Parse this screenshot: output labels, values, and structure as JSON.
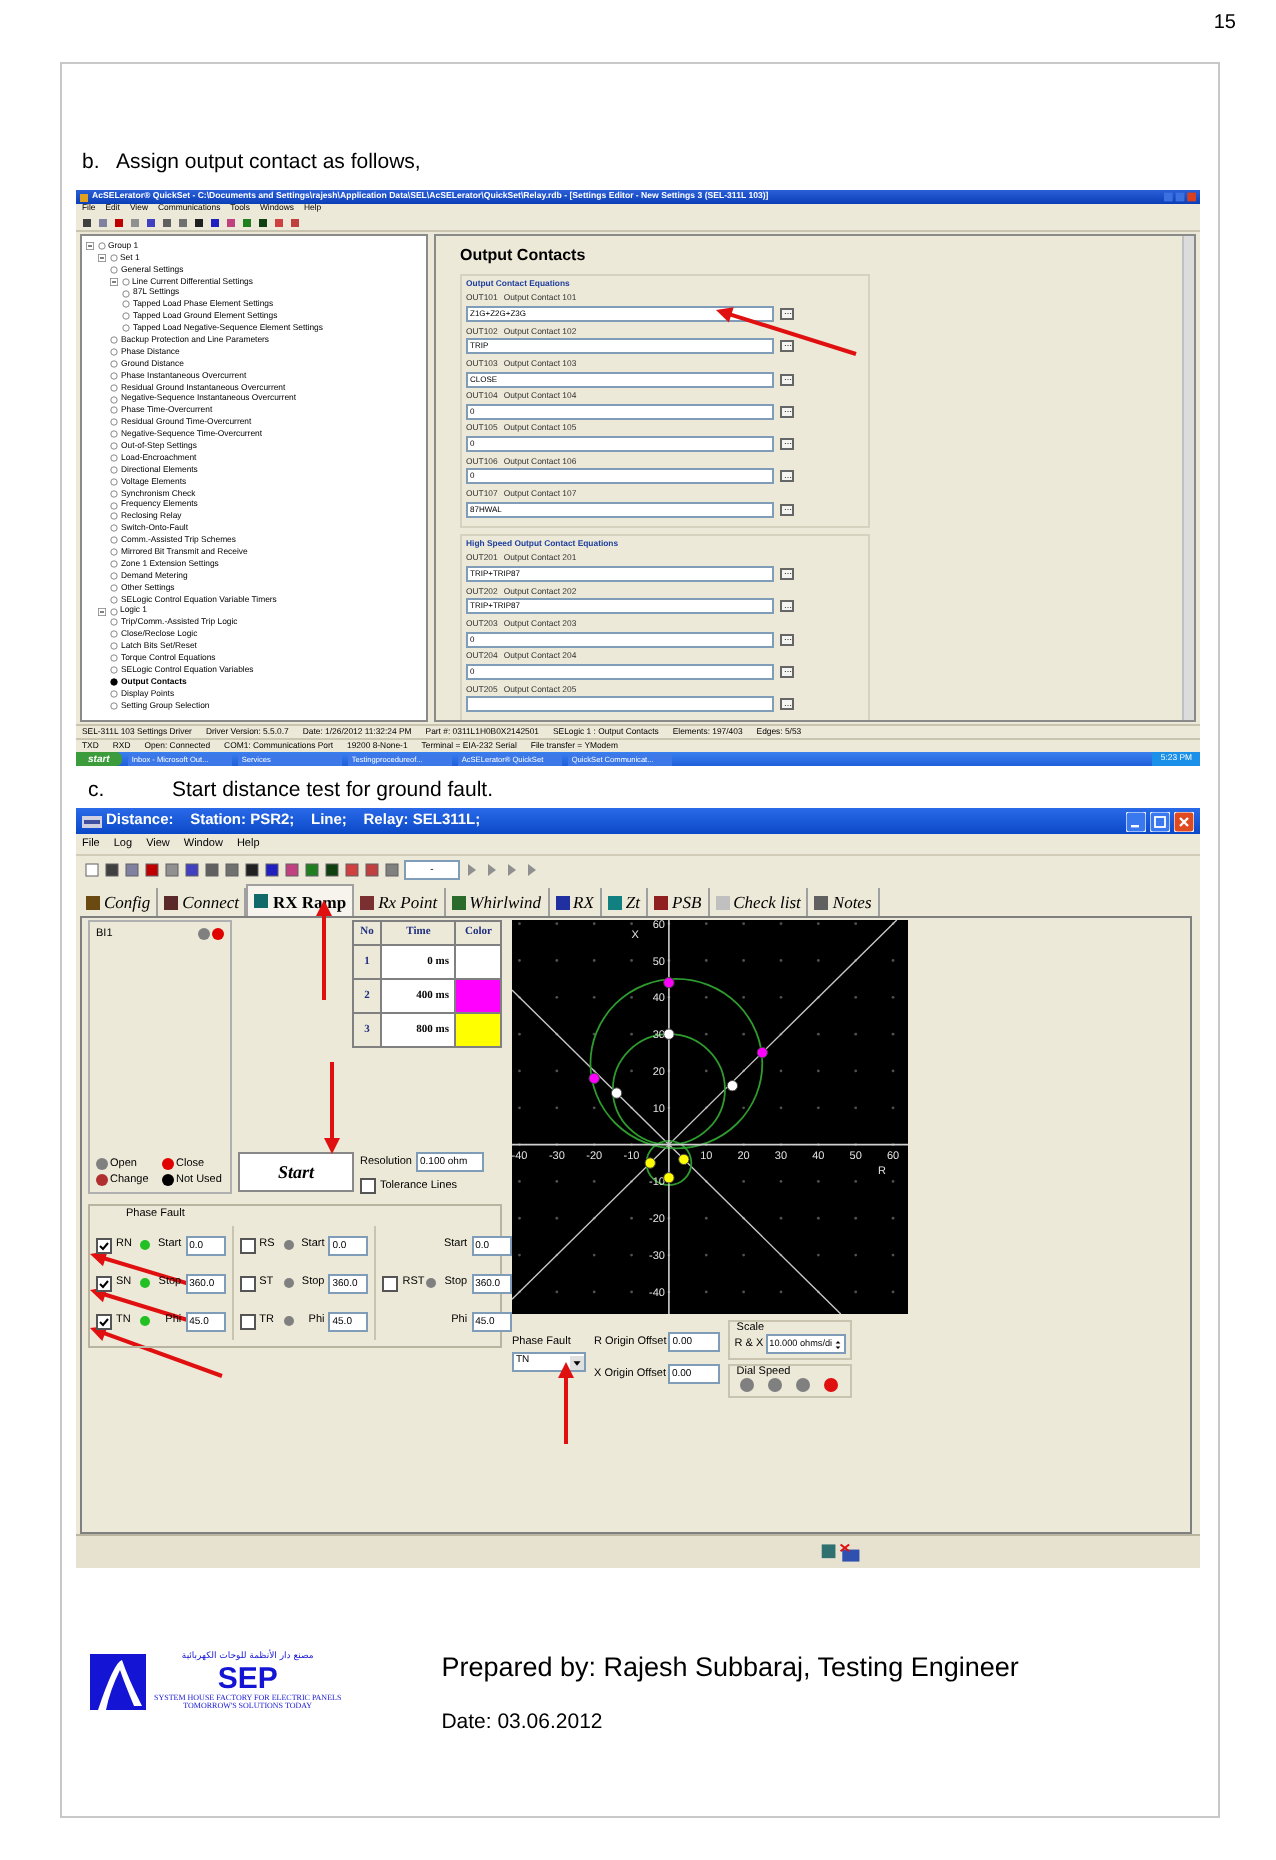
{
  "page_number": "15",
  "step_b": {
    "label": "b.",
    "text": "Assign output contact as follows,"
  },
  "quickset": {
    "title": "AcSELerator® QuickSet - C:\\Documents and Settings\\rajesh\\Application Data\\SEL\\AcSELerator\\QuickSet\\Relay.rdb - [Settings Editor - New Settings 3 (SEL-311L 103)]",
    "menu": [
      "File",
      "Edit",
      "View",
      "Communications",
      "Tools",
      "Windows",
      "Help"
    ],
    "tree": [
      {
        "label": "Group 1",
        "selected": false,
        "expanded": true,
        "children": [
          {
            "label": "Set 1",
            "selected": false,
            "expanded": true,
            "children": [
              {
                "label": "General Settings",
                "selected": false
              },
              {
                "label": "Line Current Differential Settings",
                "selected": false,
                "expanded": true,
                "children": [
                  {
                    "label": "87L Settings",
                    "selected": false
                  },
                  {
                    "label": "Tapped Load Phase Element Settings",
                    "selected": false
                  },
                  {
                    "label": "Tapped Load Ground Element Settings",
                    "selected": false
                  },
                  {
                    "label": "Tapped Load Negative-Sequence Element Settings",
                    "selected": false
                  }
                ]
              },
              {
                "label": "Backup Protection and Line Parameters",
                "selected": false
              },
              {
                "label": "Phase Distance",
                "selected": false
              },
              {
                "label": "Ground Distance",
                "selected": false
              },
              {
                "label": "Phase Instantaneous Overcurrent",
                "selected": false
              },
              {
                "label": "Residual Ground Instantaneous Overcurrent",
                "selected": false
              },
              {
                "label": "Negative-Sequence Instantaneous Overcurrent",
                "selected": false
              },
              {
                "label": "Phase Time-Overcurrent",
                "selected": false
              },
              {
                "label": "Residual Ground Time-Overcurrent",
                "selected": false
              },
              {
                "label": "Negative-Sequence Time-Overcurrent",
                "selected": false
              },
              {
                "label": "Out-of-Step Settings",
                "selected": false
              },
              {
                "label": "Load-Encroachment",
                "selected": false
              },
              {
                "label": "Directional Elements",
                "selected": false
              },
              {
                "label": "Voltage Elements",
                "selected": false
              },
              {
                "label": "Synchronism Check",
                "selected": false
              },
              {
                "label": "Frequency Elements",
                "selected": false
              },
              {
                "label": "Reclosing Relay",
                "selected": false
              },
              {
                "label": "Switch-Onto-Fault",
                "selected": false
              },
              {
                "label": "Comm.-Assisted Trip Schemes",
                "selected": false
              },
              {
                "label": "Mirrored Bit Transmit and Receive",
                "selected": false
              },
              {
                "label": "Zone 1 Extension Settings",
                "selected": false
              },
              {
                "label": "Demand Metering",
                "selected": false
              },
              {
                "label": "Other Settings",
                "selected": false
              },
              {
                "label": "SELogic Control Equation Variable Timers",
                "selected": false
              }
            ]
          },
          {
            "label": "Logic 1",
            "selected": false,
            "expanded": true,
            "children": [
              {
                "label": "Trip/Comm.-Assisted Trip Logic",
                "selected": false
              },
              {
                "label": "Close/Reclose Logic",
                "selected": false
              },
              {
                "label": "Latch Bits Set/Reset",
                "selected": false
              },
              {
                "label": "Torque Control Equations",
                "selected": false
              },
              {
                "label": "SELogic Control Equation Variables",
                "selected": false
              },
              {
                "label": "Output Contacts",
                "selected": true
              },
              {
                "label": "Display Points",
                "selected": false
              },
              {
                "label": "Setting Group Selection",
                "selected": false
              }
            ]
          }
        ]
      }
    ],
    "panel_title": "Output Contacts",
    "sections": [
      {
        "title": "Output Contact Equations",
        "fields": [
          {
            "name": "OUT101",
            "label": "Output Contact 101",
            "value": "Z1G+Z2G+Z3G"
          },
          {
            "name": "OUT102",
            "label": "Output Contact 102",
            "value": "TRIP"
          },
          {
            "name": "OUT103",
            "label": "Output Contact 103",
            "value": "CLOSE"
          },
          {
            "name": "OUT104",
            "label": "Output Contact 104",
            "value": "0"
          },
          {
            "name": "OUT105",
            "label": "Output Contact 105",
            "value": "0"
          },
          {
            "name": "OUT106",
            "label": "Output Contact 106",
            "value": "0"
          },
          {
            "name": "OUT107",
            "label": "Output Contact 107",
            "value": "87HWAL"
          }
        ]
      },
      {
        "title": "High Speed Output Contact Equations",
        "fields": [
          {
            "name": "OUT201",
            "label": "Output Contact 201",
            "value": "TRIP+TRIP87"
          },
          {
            "name": "OUT202",
            "label": "Output Contact 202",
            "value": "TRIP+TRIP87"
          },
          {
            "name": "OUT203",
            "label": "Output Contact 203",
            "value": "0"
          },
          {
            "name": "OUT204",
            "label": "Output Contact 204",
            "value": "0"
          },
          {
            "name": "OUT205",
            "label": "Output Contact 205"
          }
        ]
      }
    ],
    "status_lines": [
      [
        "SEL-311L 103 Settings Driver",
        "Driver Version: 5.5.0.7",
        "Date: 1/26/2012 11:32:24 PM",
        "Part #: 0311L1H0B0X2142501",
        "SELogic 1 : Output Contacts",
        "Elements: 197/403",
        "Edges: 5/53"
      ],
      [
        "TXD",
        "RXD",
        "Open: Connected",
        "COM1: Communications Port",
        "19200 8-None-1",
        "Terminal = EIA-232 Serial",
        "File transfer = YModem"
      ]
    ],
    "taskbar": {
      "start": "start",
      "tasks": [
        "Inbox - Microsoft Out...",
        "Services",
        "Testingprocedureof...",
        "AcSELerator® QuickSet",
        "QuickSet Communicat..."
      ],
      "clock": "5:23 PM"
    }
  },
  "step_c": {
    "label": "c.",
    "text": "Start distance test for ground fault."
  },
  "distance": {
    "title": "Distance:    Station: PSR2;    Line;    Relay: SEL311L;",
    "menu": [
      "File",
      "Log",
      "View",
      "Window",
      "Help"
    ],
    "toolbar_field": "-",
    "tabs": [
      {
        "label": "Config",
        "selected": false
      },
      {
        "label": "Connect",
        "selected": false
      },
      {
        "label": "RX Ramp",
        "selected": true
      },
      {
        "label": "Rx Point",
        "selected": false
      },
      {
        "label": "Whirlwind",
        "selected": false
      },
      {
        "label": "RX",
        "selected": false
      },
      {
        "label": "Zt",
        "selected": false
      },
      {
        "label": "PSB",
        "selected": false
      },
      {
        "label": "Check list",
        "selected": false
      },
      {
        "label": "Notes",
        "selected": false
      }
    ],
    "binary_input": {
      "label": "BI1",
      "indicators": [
        {
          "color": "#808080"
        },
        {
          "color": "#e00000"
        }
      ]
    },
    "legend": [
      {
        "label": "Open",
        "color": "#808080"
      },
      {
        "label": "Close",
        "color": "#e00000"
      },
      {
        "label": "Change",
        "color": "#b03030"
      },
      {
        "label": "Not Used",
        "color": "#000000"
      }
    ],
    "time_table": {
      "columns": [
        "No",
        "Time",
        "Color"
      ],
      "rows": [
        {
          "no": "1",
          "time": "0 ms",
          "color": "#ffffff"
        },
        {
          "no": "2",
          "time": "400 ms",
          "color": "#ff00ff"
        },
        {
          "no": "3",
          "time": "800 ms",
          "color": "#ffff00"
        }
      ]
    },
    "start_button": "Start",
    "resolution": {
      "label": "Resolution",
      "value": "0.100 ohm"
    },
    "tolerance": {
      "label": "Tolerance Lines",
      "checked": false
    },
    "chart_data": {
      "type": "scatter",
      "xlabel": "R",
      "ylabel": "X",
      "xlim": [
        -42,
        64
      ],
      "ylim": [
        -46,
        61
      ],
      "xticks": [
        -40,
        -30,
        -20,
        -10,
        10,
        20,
        30,
        40,
        50,
        60
      ],
      "yticks": [
        -40,
        -30,
        -20,
        -10,
        10,
        20,
        30,
        40,
        50,
        60
      ],
      "series": [
        {
          "color": "#ffffff",
          "x": [
            0,
            17,
            -14
          ],
          "values": [
            30,
            16,
            14
          ]
        },
        {
          "color": "#ff00ff",
          "x": [
            0,
            25,
            -20
          ],
          "values": [
            44,
            25,
            18
          ]
        },
        {
          "color": "#ffff00",
          "x": [
            -5,
            4,
            0
          ],
          "values": [
            -5,
            -4,
            -9
          ]
        }
      ]
    },
    "phase_fault": {
      "title": "Phase Fault",
      "columns": [
        [
          {
            "loop": "RN",
            "checked": true,
            "param": "Start",
            "value": "0.0"
          },
          {
            "loop": "SN",
            "checked": true,
            "param": "Stop",
            "value": "360.0"
          },
          {
            "loop": "TN",
            "checked": true,
            "param": "Phi",
            "value": "45.0"
          }
        ],
        [
          {
            "loop": "RS",
            "checked": false,
            "param": "Start",
            "value": "0.0"
          },
          {
            "loop": "ST",
            "checked": false,
            "param": "Stop",
            "value": "360.0"
          },
          {
            "loop": "TR",
            "checked": false,
            "param": "Phi",
            "value": "45.0"
          }
        ],
        [
          {
            "param": "Start",
            "value": "0.0"
          },
          {
            "loop": "RST",
            "checked": false,
            "param": "Stop",
            "value": "360.0"
          },
          {
            "param": "Phi",
            "value": "45.0"
          }
        ]
      ]
    },
    "fault_select": {
      "label": "Phase Fault",
      "value": "TN"
    },
    "r_offset": {
      "label": "R Origin Offset",
      "value": "0.00"
    },
    "x_offset": {
      "label": "X Origin Offset",
      "value": "0.00"
    },
    "scale": {
      "title": "Scale",
      "label": "R & X",
      "value": "10.000 ohms/di"
    },
    "dial_speed": {
      "title": "Dial Speed",
      "options": [
        {
          "selected": false
        },
        {
          "selected": false
        },
        {
          "selected": false
        },
        {
          "selected": true
        }
      ]
    }
  },
  "footer": {
    "logo": {
      "arabic": "مصنع دار الأنظمة للوحات الكهربائية",
      "name": "SEP",
      "line_1": "SYSTEM HOUSE FACTORY FOR ELECTRIC PANELS",
      "line_2": "TOMORROW'S SOLUTIONS TODAY"
    },
    "prepared_by": "Prepared by:  Rajesh Subbaraj, Testing Engineer",
    "date": "Date: 03.06.2012"
  }
}
